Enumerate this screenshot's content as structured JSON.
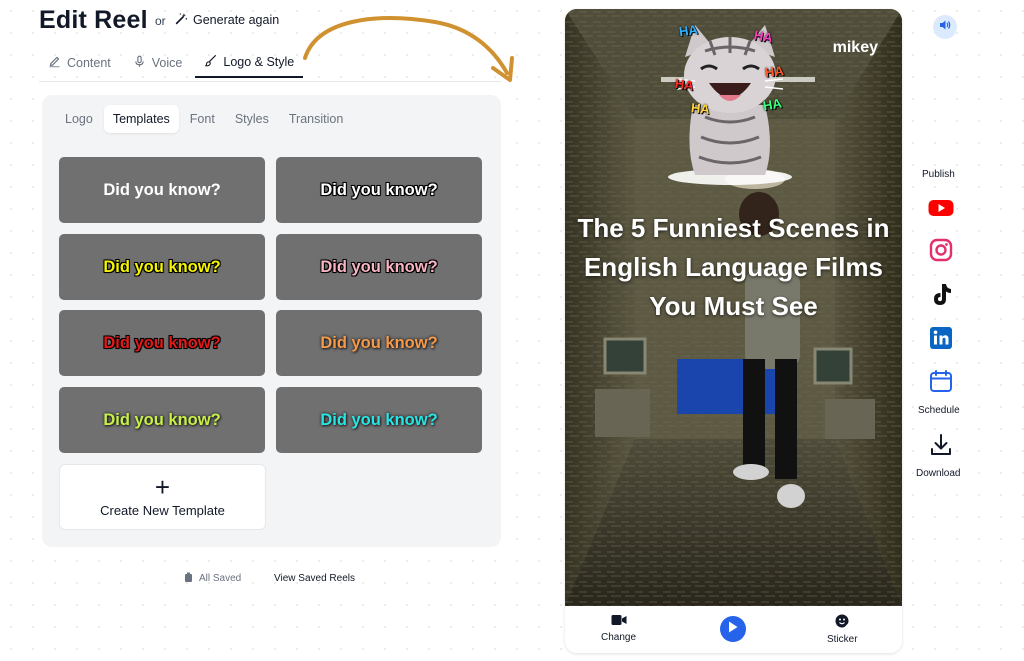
{
  "header": {
    "title": "Edit Reel",
    "or_text": "or",
    "generate_label": "Generate again"
  },
  "main_tabs": [
    {
      "label": "Content",
      "icon": "pencil-icon"
    },
    {
      "label": "Voice",
      "icon": "microphone-icon"
    },
    {
      "label": "Logo & Style",
      "icon": "brush-icon",
      "active": true
    }
  ],
  "sub_tabs": [
    {
      "label": "Logo"
    },
    {
      "label": "Templates",
      "active": true
    },
    {
      "label": "Font"
    },
    {
      "label": "Styles"
    },
    {
      "label": "Transition"
    }
  ],
  "templates": [
    {
      "text": "Did you know?",
      "color": "#ffffff",
      "style": "plain"
    },
    {
      "text": "Did you know?",
      "color": "#ffffff",
      "style": "black-outline"
    },
    {
      "text": "Did you know?",
      "color": "#f5f500",
      "style": "black-outline"
    },
    {
      "text": "Did you know?",
      "color": "#f9b4c4",
      "style": "black-outline"
    },
    {
      "text": "Did you know?",
      "color": "#e51818",
      "style": "black-outline"
    },
    {
      "text": "Did you know?",
      "color": "#f59a4a",
      "style": "soft-shadow"
    },
    {
      "text": "Did you know?",
      "color": "#c8f04a",
      "style": "soft-shadow"
    },
    {
      "text": "Did you know?",
      "color": "#28e6e6",
      "style": "soft-shadow"
    }
  ],
  "create_template_label": "Create New Template",
  "status": {
    "saved_label": "All Saved",
    "view_saved_label": "View Saved Reels"
  },
  "preview": {
    "watermark": "mikey",
    "headline": "The 5 Funniest Scenes in English Language Films You Must See",
    "sticker_words": [
      "HA",
      "HA",
      "HA",
      "HA",
      "HA",
      "HA"
    ],
    "bottom_bar": {
      "change_label": "Change",
      "sticker_label": "Sticker"
    }
  },
  "rail": {
    "publish_label": "Publish",
    "schedule_label": "Schedule",
    "download_label": "Download"
  },
  "colors": {
    "accent": "#2563eb",
    "arrow": "#d09230",
    "youtube": "#ff0000",
    "instagram": "#e1306c",
    "linkedin": "#0a66c2"
  }
}
